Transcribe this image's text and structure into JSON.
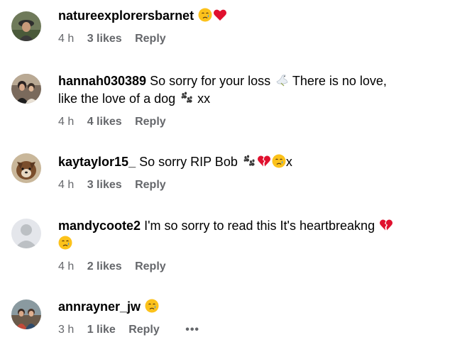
{
  "comments": [
    {
      "username": "natureexplorersbarnet",
      "text": "",
      "trailing_text": "",
      "emojis": [
        "crying-face-emoji",
        "red-heart-emoji"
      ],
      "time": "4 h",
      "likes": "3 likes",
      "reply": "Reply"
    },
    {
      "username": "hannah030389",
      "text_part1": "So sorry for your loss",
      "text_part2": "There is no love,",
      "text_line2": "like the love of a dog",
      "trailing_text": "xx",
      "emojis": [
        "dove-emoji",
        "paw-prints-emoji"
      ],
      "time": "4 h",
      "likes": "4 likes",
      "reply": "Reply"
    },
    {
      "username": "kaytaylor15_",
      "text": "So sorry RIP Bob",
      "trailing_text": "x",
      "emojis": [
        "paw-prints-emoji",
        "broken-heart-emoji",
        "crying-face-emoji"
      ],
      "time": "4 h",
      "likes": "3 likes",
      "reply": "Reply"
    },
    {
      "username": "mandycoote2",
      "text": "I'm so sorry to read this It's heartbreakng",
      "emojis": [
        "broken-heart-emoji",
        "crying-face-emoji"
      ],
      "time": "4 h",
      "likes": "2 likes",
      "reply": "Reply"
    },
    {
      "username": "annrayner_jw",
      "text": "",
      "emojis": [
        "crying-face-emoji"
      ],
      "time": "3 h",
      "likes": "1 like",
      "reply": "Reply",
      "more": "•••"
    }
  ],
  "colors": {
    "meta_gray": "#65676b",
    "heart_red": "#e0102e",
    "emoji_yellow": "#fcc21b",
    "tear_blue": "#4a9ee6",
    "default_avatar_bg": "#e4e6eb",
    "default_avatar_fg": "#bcc0c4"
  }
}
